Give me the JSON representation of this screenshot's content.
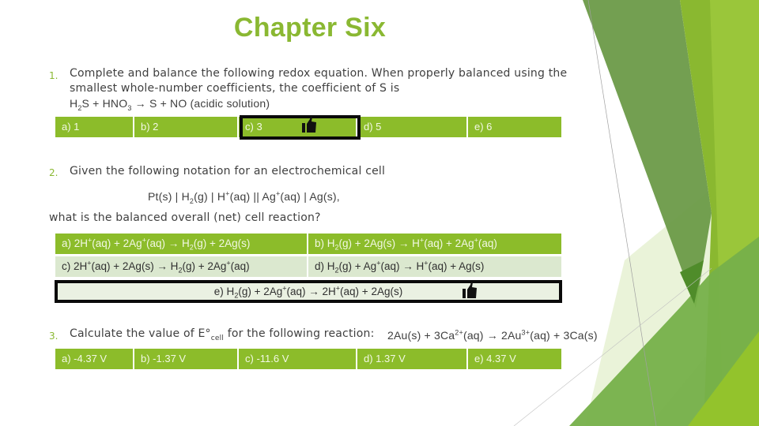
{
  "slide": {
    "title": "Chapter Six",
    "colors": {
      "accent": "#8ab832",
      "option_fill": "#8cbc2a",
      "option_fill_light": "#dbe8cf",
      "highlight_border": "#0a0a0a"
    }
  },
  "questions": [
    {
      "number": "1.",
      "text_line1": "Complete and balance the following redox equation. When properly balanced using the",
      "text_line2": "smallest whole-number coefficients, the coefficient of S is",
      "equation": {
        "p1": "H",
        "s1": "2",
        "p2": "S + HNO",
        "s2": "3",
        "p3": " → S + NO (acidic solution)"
      },
      "options": [
        {
          "label": "a) 1"
        },
        {
          "label": "b) 2"
        },
        {
          "label": "c) 3",
          "correct": true
        },
        {
          "label": "d) 5"
        },
        {
          "label": "e) 6"
        }
      ],
      "correct_icon": "thumbs-up-icon"
    },
    {
      "number": "2.",
      "text": "Given the following notation for an electrochemical cell",
      "notation": {
        "p1": "Pt(s) | H",
        "s1": "2",
        "p2": "(g) | H",
        "sup1": "+",
        "p3": "(aq) || Ag",
        "sup2": "+",
        "p4": "(aq) | Ag(s),"
      },
      "question": "what is the balanced overall (net) cell reaction?",
      "options": {
        "a": {
          "p1": "a) 2H",
          "sup1": "+",
          "p2": "(aq) + 2Ag",
          "sup2": "+",
          "p3": "(aq) → H",
          "sub1": "2",
          "p4": "(g) + 2Ag(s)"
        },
        "b": {
          "p1": "b) H",
          "sub1": "2",
          "p2": "(g) + 2Ag(s) → H",
          "sup1": "+",
          "p3": "(aq) + 2Ag",
          "sup2": "+",
          "p4": "(aq)"
        },
        "c": {
          "p1": "c) 2H",
          "sup1": "+",
          "p2": "(aq) + 2Ag(s) → H",
          "sub1": "2",
          "p3": "(g) + 2Ag",
          "sup2": "+",
          "p4": "(aq)"
        },
        "d": {
          "p1": "d) H",
          "sub1": "2",
          "p2": "(g) + Ag",
          "sup1": "+",
          "p3": "(aq) → H",
          "sup2": "+",
          "p4": "(aq) + Ag(s)"
        },
        "e": {
          "p1": "e) H",
          "sub1": "2",
          "p2": "(g) + 2Ag",
          "sup1": "+",
          "p3": "(aq) → 2H",
          "sup2": "+",
          "p4": "(aq) + 2Ag(s)",
          "correct": true
        }
      },
      "correct_icon": "thumbs-up-icon"
    },
    {
      "number": "3.",
      "text_p1": "Calculate the value of E°",
      "text_sub": "cell",
      "text_p2": " for the following reaction:",
      "reaction": {
        "p1": "2Au(s) + 3Ca",
        "sup1": "2+",
        "p2": "(aq) → 2Au",
        "sup2": "3+",
        "p3": "(aq) + 3Ca(s)"
      },
      "options": [
        {
          "label": "a) -4.37 V"
        },
        {
          "label": "b) -1.37 V"
        },
        {
          "label": "c) -11.6 V"
        },
        {
          "label": "d) 1.37 V"
        },
        {
          "label": "e) 4.37 V"
        }
      ]
    }
  ]
}
